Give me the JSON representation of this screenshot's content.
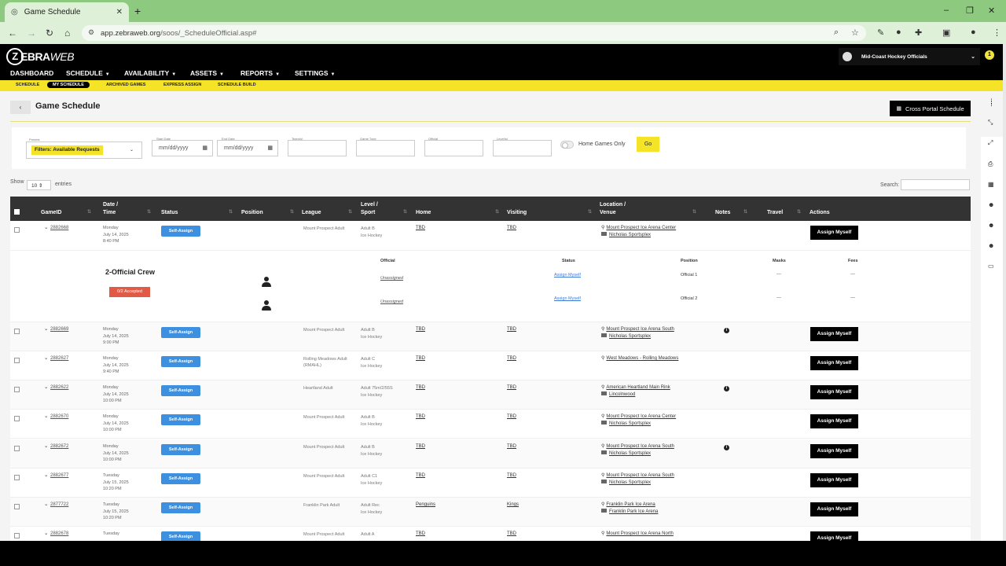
{
  "browser": {
    "tab_title": "Game Schedule",
    "tab_close": "✕",
    "new_tab": "+",
    "url_host": "app.zebraweb.org",
    "url_path": "/soos/_ScheduleOfficial.asp#",
    "win_min": "–",
    "win_max": "❐",
    "win_close": "✕"
  },
  "app": {
    "logo_z": "Z",
    "logo_ebra": "EBRA",
    "logo_web": "WEB",
    "menu": [
      "DASHBOARD",
      "SCHEDULE",
      "AVAILABILITY",
      "ASSETS",
      "REPORTS",
      "SETTINGS"
    ],
    "org_name": "Mid-Coast Hockey Officials",
    "notif_count": "1",
    "subnav": [
      "SCHEDULE",
      "MY SCHEDULE",
      "ARCHIVED GAMES",
      "EXPRESS ASSIGN",
      "SCHEDULE BUILD"
    ]
  },
  "page": {
    "title": "Game Schedule",
    "back": "‹",
    "cross_portal": "Cross Portal Schedule"
  },
  "filters": {
    "presets_label": "Presets",
    "preset_value": "Filters: Available Requests",
    "start_label": "Start Date",
    "end_label": "End Date",
    "date_placeholder": "mm/dd/yyyy",
    "team_label": "Team(s)",
    "game_type_label": "Game Type",
    "official_label": "Official",
    "levels_label": "Level(s)",
    "home_only": "Home Games Only",
    "go": "Go"
  },
  "table_controls": {
    "show": "Show",
    "show_value": "10",
    "entries": "entries",
    "search": "Search:"
  },
  "columns": {
    "gameid": "GameID",
    "date_1": "Date /",
    "date_2": "Time",
    "status": "Status",
    "position": "Position",
    "league": "League",
    "level_1": "Level /",
    "level_2": "Sport",
    "home": "Home",
    "visiting": "Visiting",
    "location_1": "Location /",
    "location_2": "Venue",
    "notes": "Notes",
    "travel": "Travel",
    "actions": "Actions"
  },
  "self_assign": "Self-Assign",
  "assign_myself": "Assign Myself",
  "crew": {
    "title": "2-Official Crew",
    "accepted": "0/2 Accepted",
    "headers": {
      "official": "Official",
      "status": "Status",
      "position": "Position",
      "masks": "Masks",
      "fees": "Fees"
    },
    "rows": [
      {
        "official": "Unassigned",
        "status": "Assign Myself",
        "position": "Official 1",
        "masks": "---",
        "fees": "---"
      },
      {
        "official": "Unassigned",
        "status": "Assign Myself",
        "position": "Official 2",
        "masks": "---",
        "fees": "---"
      }
    ]
  },
  "games": [
    {
      "id": "2882668",
      "day": "Monday",
      "date": "July 14, 2025",
      "time": "8:40 PM",
      "league": "Mount Prospect Adult",
      "level": "Adult B",
      "sport": "Ice Hockey",
      "home": "TBD",
      "visiting": "TBD",
      "location": "Mount Prospect Ice Arena Center",
      "venue": "Nicholas Sportsplex",
      "note": false
    },
    {
      "id": "2882669",
      "day": "Monday",
      "date": "July 14, 2025",
      "time": "9:00 PM",
      "league": "Mount Prospect Adult",
      "level": "Adult B",
      "sport": "Ice Hockey",
      "home": "TBD",
      "visiting": "TBD",
      "location": "Mount Prospect Ice Arena South",
      "venue": "Nicholas Sportsplex",
      "note": true
    },
    {
      "id": "2882627",
      "day": "Monday",
      "date": "July 14, 2025",
      "time": "9:40 PM",
      "league": "Rolling Meadows Adult (RMAHL)",
      "level": "Adult C",
      "sport": "Ice Hockey",
      "home": "TBD",
      "visiting": "TBD",
      "location": "West Meadows - Rolling Meadows",
      "venue": "",
      "note": false
    },
    {
      "id": "2882622",
      "day": "Monday",
      "date": "July 14, 2025",
      "time": "10:00 PM",
      "league": "Heartland Adult",
      "level": "Adult 75m/2/55S",
      "sport": "Ice Hockey",
      "home": "TBD",
      "visiting": "TBD",
      "location": "American Heartland Main Rink",
      "venue": "Lincolnwood",
      "note": true
    },
    {
      "id": "2882670",
      "day": "Monday",
      "date": "July 14, 2025",
      "time": "10:00 PM",
      "league": "Mount Prospect Adult",
      "level": "Adult B",
      "sport": "Ice Hockey",
      "home": "TBD",
      "visiting": "TBD",
      "location": "Mount Prospect Ice Arena Center",
      "venue": "Nicholas Sportsplex",
      "note": false
    },
    {
      "id": "2882672",
      "day": "Monday",
      "date": "July 14, 2025",
      "time": "10:00 PM",
      "league": "Mount Prospect Adult",
      "level": "Adult B",
      "sport": "Ice Hockey",
      "home": "TBD",
      "visiting": "TBD",
      "location": "Mount Prospect Ice Arena South",
      "venue": "Nicholas Sportsplex",
      "note": true
    },
    {
      "id": "2882677",
      "day": "Tuesday",
      "date": "July 15, 2025",
      "time": "10:20 PM",
      "league": "Mount Prospect Adult",
      "level": "Adult C1",
      "sport": "Ice Hockey",
      "home": "TBD",
      "visiting": "TBD",
      "location": "Mount Prospect Ice Arena South",
      "venue": "Nicholas Sportsplex",
      "note": false
    },
    {
      "id": "2877722",
      "day": "Tuesday",
      "date": "July 15, 2025",
      "time": "10:20 PM",
      "league": "Franklin Park Adult",
      "level": "Adult Rec",
      "sport": "Ice Hockey",
      "home": "Penguins",
      "visiting": "Kings",
      "location": "Franklin Park Ice Arena",
      "venue": "Franklin Park Ice Arena",
      "note": false
    },
    {
      "id": "2882678",
      "day": "Tuesday",
      "date": "",
      "time": "",
      "league": "Mount Prospect Adult",
      "level": "Adult A",
      "sport": "",
      "home": "TBD",
      "visiting": "TBD",
      "location": "Mount Prospect Ice Arena North",
      "venue": "",
      "note": false
    }
  ]
}
